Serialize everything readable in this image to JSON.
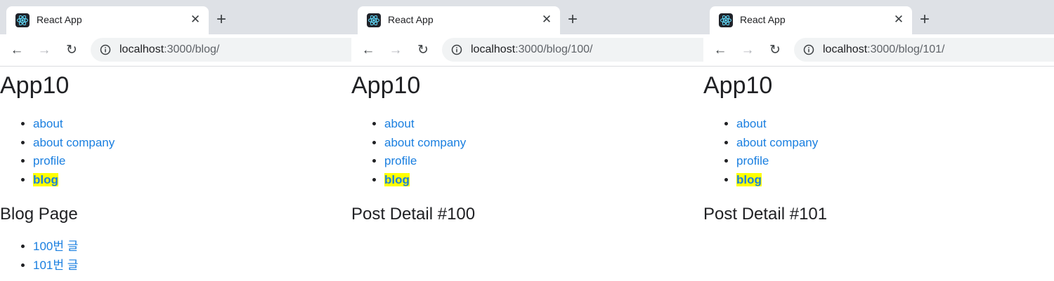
{
  "windows": [
    {
      "tab_title": "React App",
      "url_host": "localhost",
      "url_rest": ":3000/blog/",
      "app_title": "App10",
      "nav_links": [
        "about",
        "about company",
        "profile"
      ],
      "active_link": "blog",
      "heading": "Blog Page",
      "posts": [
        "100번 글",
        "101번 글"
      ]
    },
    {
      "tab_title": "React App",
      "url_host": "localhost",
      "url_rest": ":3000/blog/100/",
      "app_title": "App10",
      "nav_links": [
        "about",
        "about company",
        "profile"
      ],
      "active_link": "blog",
      "heading": "Post Detail #100"
    },
    {
      "tab_title": "React App",
      "url_host": "localhost",
      "url_rest": ":3000/blog/101/",
      "app_title": "App10",
      "nav_links": [
        "about",
        "about company",
        "profile"
      ],
      "active_link": "blog",
      "heading": "Post Detail #101"
    }
  ],
  "icons": {
    "favicon": "react-logo-icon",
    "back": "arrow-left-icon",
    "forward": "arrow-right-icon",
    "reload": "reload-icon",
    "info": "info-icon",
    "close": "close-icon",
    "new_tab": "plus-icon"
  },
  "colors": {
    "link": "#1a7fe0",
    "active_highlight": "#ffff00",
    "tabstrip": "#dee1e6"
  }
}
